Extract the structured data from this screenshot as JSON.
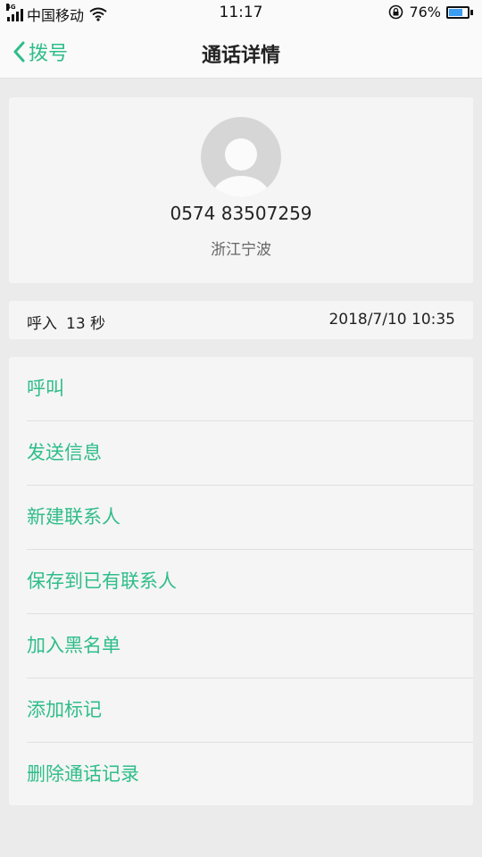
{
  "status_bar": {
    "network": "4G",
    "carrier": "中国移动",
    "time": "11:17",
    "battery_percent": "76%",
    "battery_level": 0.76
  },
  "header": {
    "back_label": "拨号",
    "title": "通话详情"
  },
  "contact": {
    "phone_number": "0574 83507259",
    "location": "浙江宁波"
  },
  "call_record": {
    "type": "呼入",
    "duration": "13 秒",
    "datetime": "2018/7/10 10:35"
  },
  "actions": [
    {
      "label": "呼叫"
    },
    {
      "label": "发送信息"
    },
    {
      "label": "新建联系人"
    },
    {
      "label": "保存到已有联系人"
    },
    {
      "label": "加入黑名单"
    },
    {
      "label": "添加标记"
    },
    {
      "label": "删除通话记录"
    }
  ],
  "colors": {
    "accent": "#2fbd8a",
    "background": "#ebebeb",
    "card": "#f5f5f5",
    "battery_fill": "#3b9cf2"
  }
}
